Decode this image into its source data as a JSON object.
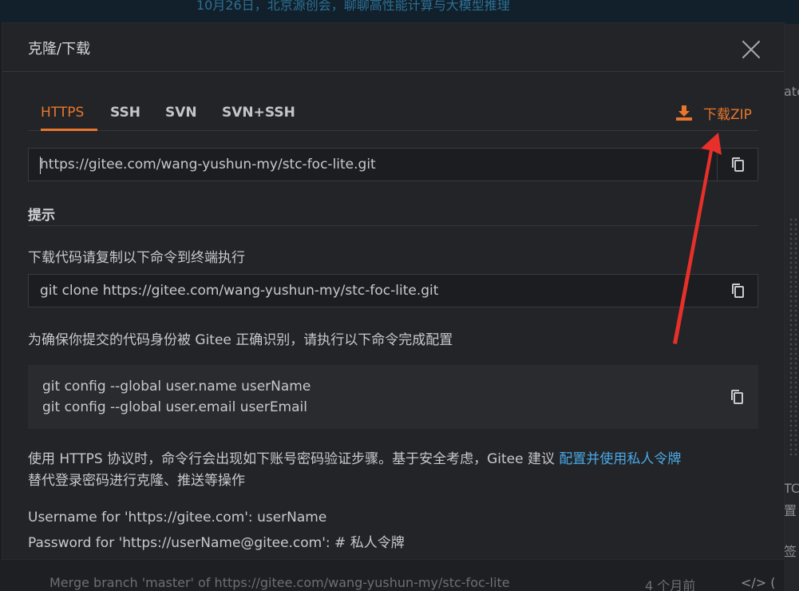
{
  "background": {
    "banner_text": "10月26日，北京源创会，聊聊高性能计算与大模型推理",
    "right_fragments": [
      "ate",
      "TC",
      "置",
      "签"
    ],
    "commit_text": "Merge branch 'master' of https://gitee.com/wang-yushun-my/stc-foc-lite",
    "commit_time": "4 个月前",
    "code_icon_text": "</> ("
  },
  "modal": {
    "title": "克隆/下载",
    "close_icon": "close-icon",
    "tabs": [
      {
        "label": "HTTPS",
        "active": true
      },
      {
        "label": "SSH",
        "active": false
      },
      {
        "label": "SVN",
        "active": false
      },
      {
        "label": "SVN+SSH",
        "active": false
      }
    ],
    "download_zip": {
      "label": "下载ZIP",
      "icon": "download-icon"
    },
    "clone_url": "https://gitee.com/wang-yushun-my/stc-foc-lite.git",
    "tip_title": "提示",
    "step1_text": "下载代码请复制以下命令到终端执行",
    "clone_command": "git clone https://gitee.com/wang-yushun-my/stc-foc-lite.git",
    "step2_text": "为确保你提交的代码身份被 Gitee 正确识别，请执行以下命令完成配置",
    "config_lines": [
      "git config --global user.name userName",
      "git config --global user.email userEmail"
    ],
    "note_text": "使用 HTTPS 协议时，命令行会出现如下账号密码验证步骤。基于安全考虑，Gitee 建议 ",
    "note_link": "配置并使用私人令牌",
    "note_text_after": "替代登录密码进行克隆、推送等操作",
    "username_prompt": "Username for 'https://gitee.com': userName",
    "password_prompt": "Password for 'https://userName@gitee.com': # 私人令牌"
  },
  "colors": {
    "accent": "#e8762d",
    "link": "#4aa9e6",
    "annotation_arrow": "#e8302a"
  }
}
